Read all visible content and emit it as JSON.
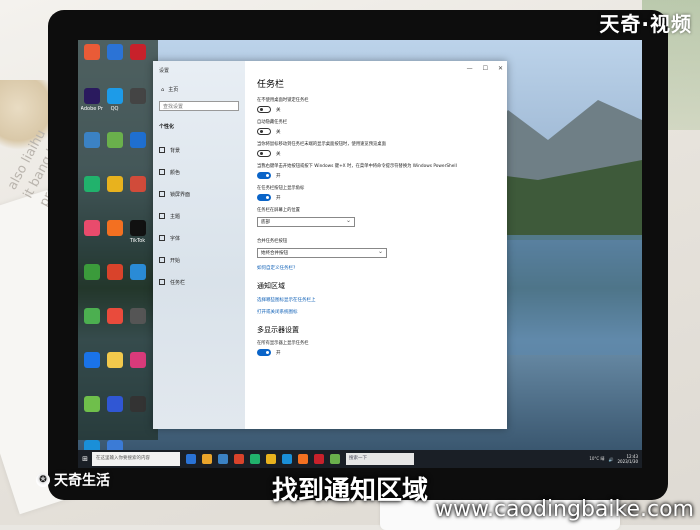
{
  "overlay": {
    "brand_top": "天奇·视频",
    "brand_bottom": "天奇生活",
    "brand_mark": "✪",
    "caption": "找到通知区域",
    "url": "www.caodingbaike.com"
  },
  "desk": {
    "paper_text_lines": [
      "also liaihu",
      "it bang lengu",
      "produ..."
    ]
  },
  "desktop": {
    "icons": [
      {
        "label": "",
        "color": "#e95b37"
      },
      {
        "label": "",
        "color": "#2b73d6"
      },
      {
        "label": "",
        "color": "#c8212b"
      },
      {
        "label": "Adobe Premi...",
        "color": "#2a1a5e"
      },
      {
        "label": "QQ",
        "color": "#1d9be8"
      },
      {
        "label": "",
        "color": "#444"
      },
      {
        "label": "",
        "color": "#3b82c4"
      },
      {
        "label": "",
        "color": "#6ab04c"
      },
      {
        "label": "",
        "color": "#1f6fd0"
      },
      {
        "label": "",
        "color": "#21b26c"
      },
      {
        "label": "",
        "color": "#e8b21e"
      },
      {
        "label": "",
        "color": "#d14b3a"
      },
      {
        "label": "",
        "color": "#e94b6c"
      },
      {
        "label": "",
        "color": "#f37021"
      },
      {
        "label": "TikTok",
        "color": "#111"
      },
      {
        "label": "",
        "color": "#3b9b3b"
      },
      {
        "label": "",
        "color": "#d9432b"
      },
      {
        "label": "",
        "color": "#2a8bd6"
      },
      {
        "label": "",
        "color": "#4caf50"
      },
      {
        "label": "",
        "color": "#e94b3c"
      },
      {
        "label": "",
        "color": "#555"
      },
      {
        "label": "",
        "color": "#1a73e8"
      },
      {
        "label": "",
        "color": "#f2c94c"
      },
      {
        "label": "",
        "color": "#d93a7a"
      },
      {
        "label": "",
        "color": "#6fbf4b"
      },
      {
        "label": "",
        "color": "#3057d4"
      },
      {
        "label": "",
        "color": "#333"
      },
      {
        "label": "Microsoft Edge",
        "color": "#1a8fd8"
      },
      {
        "label": "",
        "color": "#3b7bd6"
      }
    ]
  },
  "window": {
    "title": "设置",
    "controls": [
      "—",
      "☐",
      "✕"
    ],
    "sidebar": {
      "home": "主页",
      "search_placeholder": "查找设置",
      "group": "个性化",
      "items": [
        "背景",
        "颜色",
        "锁屏界面",
        "主题",
        "字体",
        "开始",
        "任务栏"
      ]
    },
    "content": {
      "title": "任务栏",
      "settings": [
        {
          "text": "在不使用桌面时锁定任务栏",
          "state": "关",
          "on": false
        },
        {
          "text": "自动隐藏任务栏",
          "state": "关",
          "on": false
        },
        {
          "text": "当你将鼠标移动到任务栏末端的显示桌面按钮时，使用速览预览桌面",
          "state": "关",
          "on": false
        },
        {
          "text": "当我右键单击开始按钮或按下 Windows 键+X 时，在菜单中将命令提示符替换为 Windows PowerShell",
          "state": "开",
          "on": true
        },
        {
          "text": "在任务栏按钮上显示角标",
          "state": "开",
          "on": true
        }
      ],
      "position": {
        "label": "任务栏在屏幕上的位置",
        "value": "底部"
      },
      "combine": {
        "label": "合并任务栏按钮",
        "value": "始终合并按钮"
      },
      "customize_link": "如何自定义任务栏?",
      "notify_title": "通知区域",
      "notify_links": [
        "选择哪些图标显示在任务栏上",
        "打开或关闭系统图标"
      ],
      "multi_title": "多显示器设置",
      "multi_setting": {
        "text": "在所有显示器上显示任务栏",
        "state": "开",
        "on": true
      }
    }
  },
  "taskbar": {
    "start": "⊞",
    "search_placeholder": "在这里输入你要搜索的内容",
    "search2": "搜索一下",
    "apps": [
      "#2a73d6",
      "#e9a42b",
      "#3b82c4",
      "#d9432b",
      "#21b26c",
      "#e8b21e",
      "#1a8fd8",
      "#f37021",
      "#c8212b",
      "#6ab04c"
    ],
    "weather": "10°C 晴",
    "clock_time": "12:43",
    "clock_date": "2023/1/30"
  }
}
